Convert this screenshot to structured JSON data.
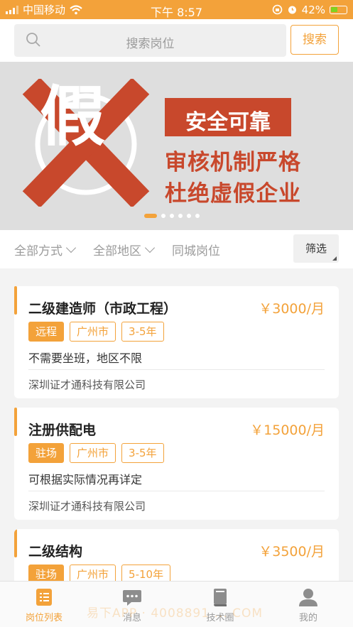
{
  "status_bar": {
    "carrier": "中国移动",
    "time": "下午 8:57",
    "battery_percent": "42%",
    "icons": [
      "signal-icon",
      "wifi-icon",
      "orientation-lock-icon",
      "alarm-icon",
      "battery-charging-icon"
    ]
  },
  "search": {
    "placeholder": "搜索岗位",
    "button_label": "搜索"
  },
  "banner": {
    "graphic_char": "假",
    "tag": "安全可靠",
    "line1": "审核机制严格",
    "line2": "杜绝虚假企业",
    "page_count": 6,
    "active_page": 1,
    "colors": {
      "accent": "#c8482c",
      "background": "#dedede"
    }
  },
  "filters": {
    "method": "全部方式",
    "region": "全部地区",
    "local": "同城岗位",
    "filter_button": "筛选"
  },
  "jobs": [
    {
      "title": "二级建造师（市政工程）",
      "salary": "￥3000/月",
      "tags": [
        "远程",
        "广州市",
        "3-5年"
      ],
      "description": "不需要坐班，地区不限",
      "company": "深圳证才通科技有限公司"
    },
    {
      "title": "注册供配电",
      "salary": "￥15000/月",
      "tags": [
        "驻场",
        "广州市",
        "3-5年"
      ],
      "description": "可根据实际情况再详定",
      "company": "深圳证才通科技有限公司"
    },
    {
      "title": "二级结构",
      "salary": "￥3500/月",
      "tags": [
        "驻场",
        "广州市",
        "5-10年"
      ],
      "description": "",
      "company": ""
    }
  ],
  "tab_bar": {
    "items": [
      {
        "label": "岗位列表",
        "icon": "list-icon",
        "active": true
      },
      {
        "label": "消息",
        "icon": "message-icon",
        "active": false
      },
      {
        "label": "技术圈",
        "icon": "book-icon",
        "active": false
      },
      {
        "label": "我的",
        "icon": "user-icon",
        "active": false
      }
    ]
  },
  "watermark": "易下APP · 4008891 ... COM",
  "colors": {
    "brand": "#f3a23a",
    "text": "#222222",
    "muted": "#9b9b9b"
  }
}
